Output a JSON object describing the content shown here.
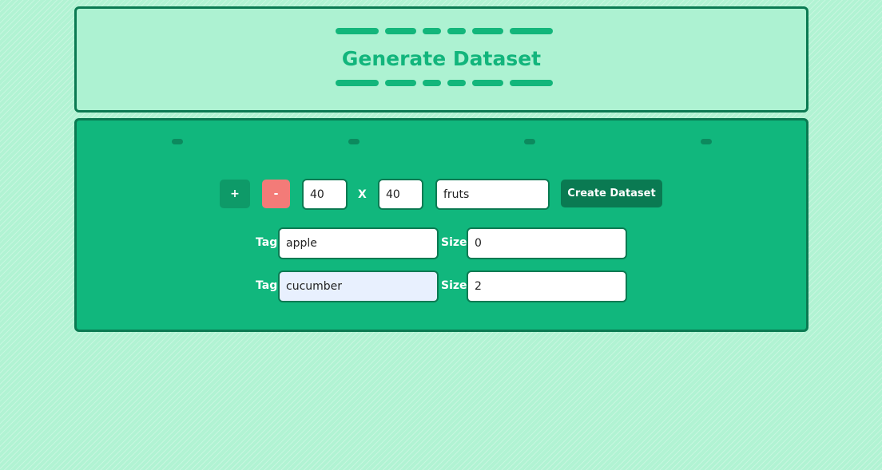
{
  "header": {
    "title": "Generate Dataset"
  },
  "controls": {
    "add_label": "+",
    "remove_label": "-",
    "width_value": "40",
    "times_label": "X",
    "height_value": "40",
    "name_value": "fruts",
    "create_label": "Create Dataset"
  },
  "rows": [
    {
      "tag_label": "Tag",
      "tag_value": "apple",
      "size_label": "Size",
      "size_value": "0"
    },
    {
      "tag_label": "Tag",
      "tag_value": "cucumber",
      "size_label": "Size",
      "size_value": "2"
    }
  ],
  "colors": {
    "background": "#b1f3d3",
    "panel": "#11b77d",
    "accent": "#13b67b",
    "border": "#0b7a52",
    "danger": "#f37b78"
  }
}
